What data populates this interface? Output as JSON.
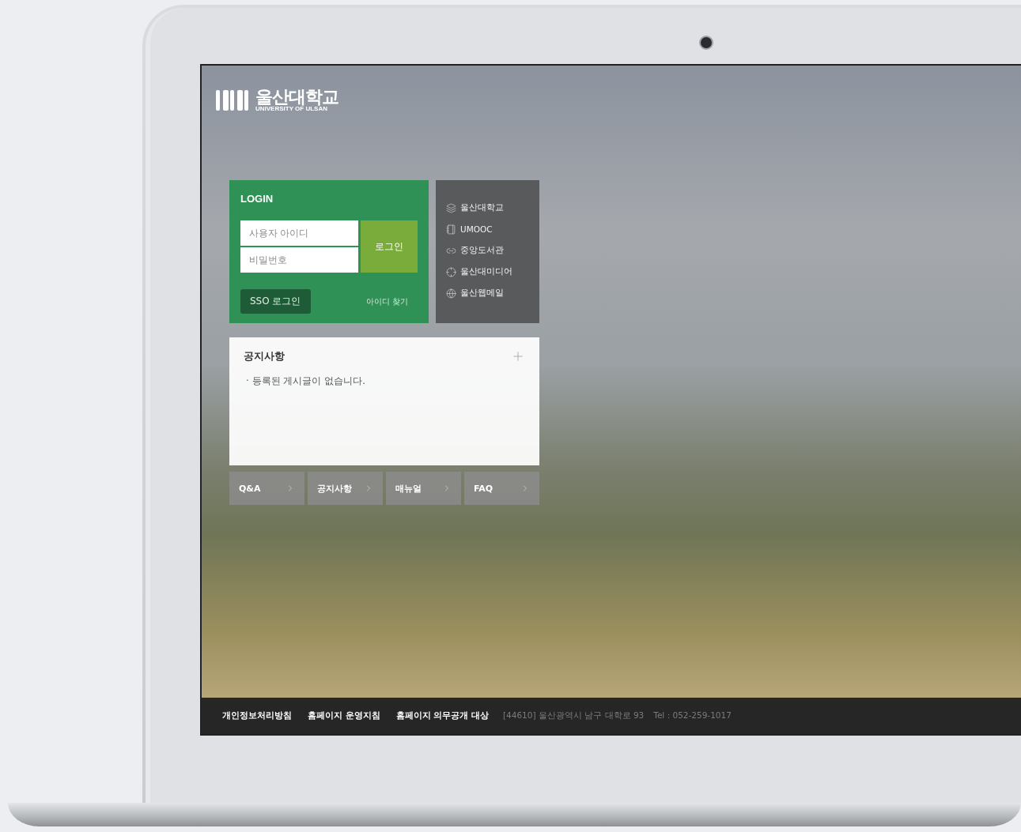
{
  "logo": {
    "name": "울산대학교",
    "subtitle": "UNIVERSITY OF ULSAN"
  },
  "login": {
    "title": "LOGIN",
    "id_field": {
      "placeholder": "사용자 아이디"
    },
    "password_field": {
      "placeholder": "비밀번호"
    },
    "submit": "로그인",
    "sso": "SSO 로그인",
    "find_id": "아이디 찾기"
  },
  "sites": [
    {
      "label": "울산대학교",
      "kind": "layers"
    },
    {
      "label": "UMOOC",
      "kind": "book"
    },
    {
      "label": "중앙도서관",
      "kind": "link"
    },
    {
      "label": "울산대미디어",
      "kind": "crosshair"
    },
    {
      "label": "울산웹메일",
      "kind": "globe"
    }
  ],
  "notice": {
    "title": "공지사항",
    "items": [
      "· 등록된 게시글이 없습니다."
    ]
  },
  "quick_links": [
    {
      "label": "Q&A"
    },
    {
      "label": "공지사항"
    },
    {
      "label": "매뉴얼"
    },
    {
      "label": "FAQ"
    }
  ],
  "footer": {
    "links": [
      "개인정보처리방침",
      "홈페이지 운영지침",
      "홈페이지 의무공개 대상"
    ],
    "address": "[44610] 울산광역시 남구 대학로 93",
    "tel": "Tel : 052-259-1017"
  }
}
